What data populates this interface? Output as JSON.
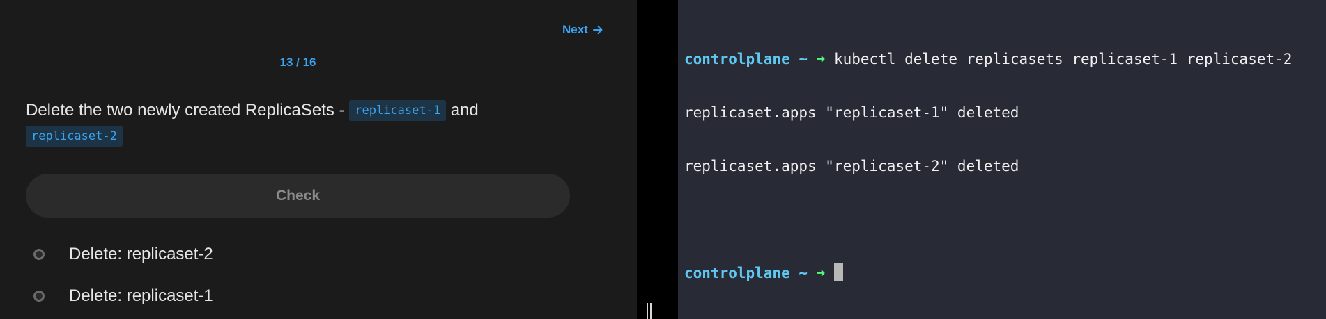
{
  "quiz": {
    "next_label": "Next",
    "progress": "13 / 16",
    "question": {
      "prefix": "Delete the two newly created ReplicaSets - ",
      "code1": "replicaset-1",
      "middle": " and",
      "code2": "replicaset-2"
    },
    "check_label": "Check",
    "tasks": [
      {
        "label": "Delete: replicaset-2"
      },
      {
        "label": "Delete: replicaset-1"
      }
    ]
  },
  "terminal": {
    "lines": [
      {
        "host": "controlplane ~",
        "arrow": "➜",
        "command": " kubectl delete replicasets replicaset-1 replicaset-2"
      },
      {
        "output": "replicaset.apps \"replicaset-1\" deleted"
      },
      {
        "output": "replicaset.apps \"replicaset-2\" deleted"
      },
      {
        "output": ""
      },
      {
        "host": "controlplane ~",
        "arrow": "➜",
        "command": " "
      }
    ]
  },
  "colors": {
    "accent": "#3ba4f0",
    "prompt_host": "#5fc8f0",
    "prompt_arrow": "#50fa7b",
    "terminal_bg": "#282a36",
    "panel_bg": "#1b1b1c"
  },
  "icons": {
    "next": "arrow-right-icon",
    "task": "radio-circle-icon",
    "divider": "drag-handle-icon"
  }
}
